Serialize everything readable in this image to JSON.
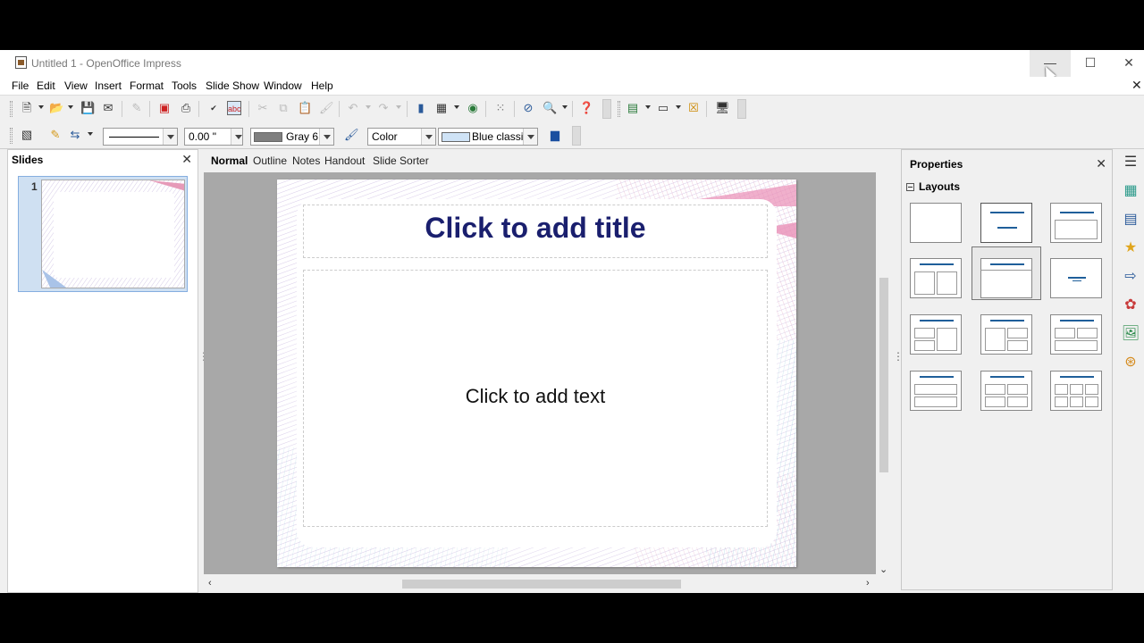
{
  "window": {
    "title": "Untitled 1 - OpenOffice Impress",
    "minimize": "—",
    "maximize": "☐",
    "close": "✕",
    "doc_close": "✕"
  },
  "menu": [
    "File",
    "Edit",
    "View",
    "Insert",
    "Format",
    "Tools",
    "Slide Show",
    "Window",
    "Help"
  ],
  "toolbar2": {
    "line_width": "0.00 \"",
    "line_color": {
      "label": "Gray 6",
      "hex": "#7f7f7f"
    },
    "area_style": "Color",
    "area_color": {
      "label": "Blue classic",
      "hex": "#cfe3f6"
    }
  },
  "slides_pane": {
    "title": "Slides",
    "close": "✕",
    "slide_number": "1"
  },
  "view_tabs": [
    "Normal",
    "Outline",
    "Notes",
    "Handout",
    "Slide Sorter"
  ],
  "slide": {
    "title_placeholder": "Click to add title",
    "body_placeholder": "Click to add text"
  },
  "properties": {
    "title": "Properties",
    "close": "✕",
    "section": "Layouts"
  },
  "colors": {
    "title_text": "#1a1f6e",
    "layout_line": "#1f5f9a",
    "selection": "#cfe0f2"
  }
}
